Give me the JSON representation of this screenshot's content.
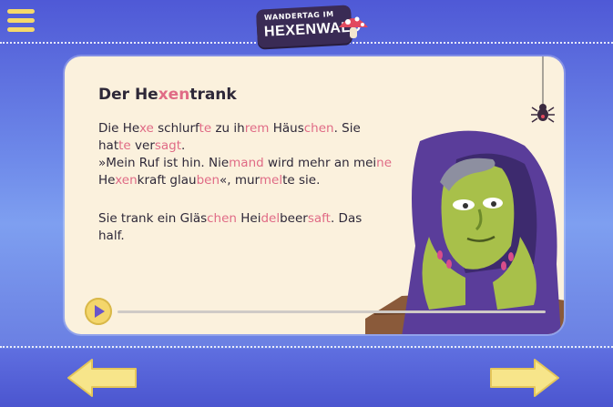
{
  "header": {
    "logo_line1": "WANDERTAG IM",
    "logo_line2": "HEXENWALD"
  },
  "story": {
    "title_parts": [
      "Der He",
      "xen",
      "trank"
    ],
    "paragraph1": [
      [
        [
          "Die He",
          0
        ],
        [
          "xe",
          1
        ],
        [
          " schlurf",
          0
        ],
        [
          "te",
          1
        ],
        [
          " zu ih",
          0
        ],
        [
          "rem",
          1
        ],
        [
          " Häus",
          0
        ],
        [
          "chen",
          1
        ],
        [
          ". Sie",
          0
        ]
      ],
      [
        [
          "hat",
          0
        ],
        [
          "te",
          1
        ],
        [
          " ver",
          0
        ],
        [
          "sagt",
          1
        ],
        [
          ".",
          0
        ]
      ],
      [
        [
          "»Mein Ruf ist hin. Nie",
          0
        ],
        [
          "mand",
          1
        ],
        [
          " wird mehr an mei",
          0
        ],
        [
          "ne",
          1
        ]
      ],
      [
        [
          "He",
          0
        ],
        [
          "xen",
          1
        ],
        [
          "kraft glau",
          0
        ],
        [
          "ben",
          1
        ],
        [
          "«, mur",
          0
        ],
        [
          "mel",
          1
        ],
        [
          "te sie.",
          0
        ]
      ]
    ],
    "paragraph2": [
      [
        [
          "Sie trank ein Gläs",
          0
        ],
        [
          "chen",
          1
        ],
        [
          " Hei",
          0
        ],
        [
          "del",
          1
        ],
        [
          "beer",
          0
        ],
        [
          "saft",
          1
        ],
        [
          ". Das",
          0
        ]
      ],
      [
        [
          "half.",
          0
        ]
      ]
    ]
  },
  "audio": {
    "progress": 0
  },
  "nav": {
    "back": "arrow-left-icon",
    "next": "arrow-right-icon"
  },
  "colors": {
    "highlight": "#e06b86",
    "accent": "#f4d66b",
    "card": "#fbf1dd"
  }
}
